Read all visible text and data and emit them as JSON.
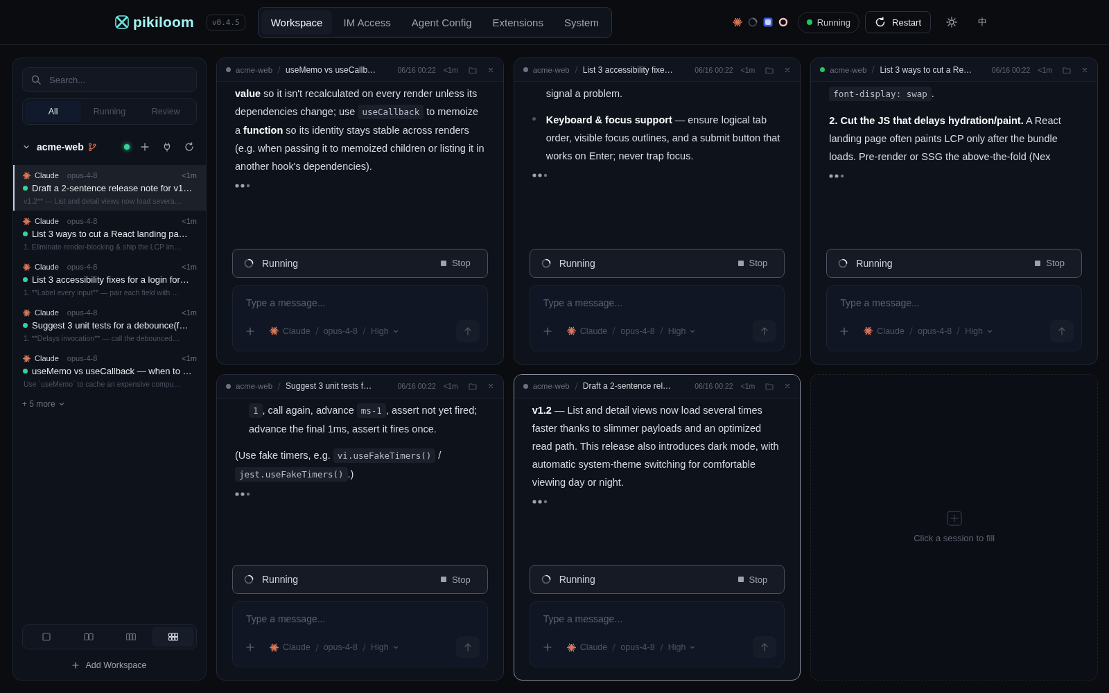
{
  "header": {
    "logo": "pikiloom",
    "version": "v0.4.5",
    "tabs": [
      {
        "label": "Workspace",
        "selected": true
      },
      {
        "label": "IM Access",
        "selected": false
      },
      {
        "label": "Agent Config",
        "selected": false
      },
      {
        "label": "Extensions",
        "selected": false
      },
      {
        "label": "System",
        "selected": false
      }
    ],
    "status": "Running",
    "restart": "Restart",
    "language": "中"
  },
  "sidebar": {
    "search": {
      "placeholder": "Search..."
    },
    "filters": [
      {
        "label": "All",
        "selected": true
      },
      {
        "label": "Running",
        "selected": false
      },
      {
        "label": "Review",
        "selected": false
      }
    ],
    "workspace": {
      "name": "acme-web",
      "expanded": true,
      "sessions": [
        {
          "agent": "Claude",
          "model": "opus-4-8",
          "age": "<1m",
          "title": "Draft a 2-sentence release note for v1…",
          "preview": "v1.2** — List and detail views now load severa…",
          "running": true,
          "selected": true
        },
        {
          "agent": "Claude",
          "model": "opus-4-8",
          "age": "<1m",
          "title": "List 3 ways to cut a React landing pa…",
          "preview": "1. Eliminate render-blocking & ship the LCP im…",
          "running": true,
          "selected": false
        },
        {
          "agent": "Claude",
          "model": "opus-4-8",
          "age": "<1m",
          "title": "List 3 accessibility fixes for a login for…",
          "preview": "1. **Label every input** — pair each field with …",
          "running": true,
          "selected": false
        },
        {
          "agent": "Claude",
          "model": "opus-4-8",
          "age": "<1m",
          "title": "Suggest 3 unit tests for a debounce(f…",
          "preview": "1. **Delays invocation** — call the debounced…",
          "running": true,
          "selected": false
        },
        {
          "agent": "Claude",
          "model": "opus-4-8",
          "age": "<1m",
          "title": "useMemo vs useCallback — when to …",
          "preview": "Use `useMemo` to cache an expensive compu…",
          "running": true,
          "selected": false
        }
      ],
      "more": "+ 5 more"
    },
    "layouts": [
      {
        "kind": "single",
        "selected": false
      },
      {
        "kind": "double",
        "selected": false
      },
      {
        "kind": "triple",
        "selected": false
      },
      {
        "kind": "grid",
        "selected": true
      }
    ],
    "add_workspace": "Add Workspace"
  },
  "panels": [
    {
      "workspace": "acme-web",
      "title": "useMemo vs useCallb…",
      "date": "06/16 00:22",
      "age": "<1m",
      "connected": false,
      "focused": false,
      "blocks": [
        {
          "kind": "para",
          "segments": [
            {
              "kind": "text",
              "text": "**value** so it isn't recalculated on every render unless its dependencies change; use "
            },
            {
              "kind": "code",
              "text": "useCallback"
            },
            {
              "kind": "text",
              "text": " to memoize a **function** so its identity stays stable across renders (e.g. when passing it to memoized children or listing it in another hook's dependencies)."
            }
          ]
        }
      ],
      "run_status": "Running",
      "stop": "Stop",
      "composer": {
        "placeholder": "Type a message...",
        "agent": "Claude",
        "model": "opus-4-8",
        "effort": "High"
      }
    },
    {
      "workspace": "acme-web",
      "title": "List 3 accessibility fixe…",
      "date": "06/16 00:22",
      "age": "<1m",
      "connected": false,
      "focused": false,
      "blocks": [
        {
          "kind": "item_cont",
          "segments": [
            {
              "kind": "text",
              "text": "signal a problem."
            }
          ]
        },
        {
          "kind": "item",
          "segments": [
            {
              "kind": "text",
              "text": "**Keyboard & focus support** — ensure logical tab order, visible focus outlines, and a submit button that works on Enter; never trap focus."
            }
          ]
        }
      ],
      "run_status": "Running",
      "stop": "Stop",
      "composer": {
        "placeholder": "Type a message...",
        "agent": "Claude",
        "model": "opus-4-8",
        "effort": "High"
      }
    },
    {
      "workspace": "acme-web",
      "title": "List 3 ways to cut a Re…",
      "date": "06/16 00:22",
      "age": "<1m",
      "connected": true,
      "focused": false,
      "blocks": [
        {
          "kind": "para",
          "segments": [
            {
              "kind": "code",
              "text": "font-display: swap"
            },
            {
              "kind": "text",
              "text": "."
            }
          ]
        },
        {
          "kind": "para",
          "segments": [
            {
              "kind": "text",
              "text": "**2. Cut the JS that delays hydration/paint.** A React landing page often paints LCP only after the bundle loads. Pre-render or SSG the above-the-fold (Nex"
            }
          ]
        }
      ],
      "run_status": "Running",
      "stop": "Stop",
      "composer": {
        "placeholder": "Type a message...",
        "agent": "Claude",
        "model": "opus-4-8",
        "effort": "High"
      }
    },
    {
      "workspace": "acme-web",
      "title": "Suggest 3 unit tests f…",
      "date": "06/16 00:22",
      "age": "<1m",
      "connected": false,
      "focused": false,
      "blocks": [
        {
          "kind": "item_cont",
          "segments": [
            {
              "kind": "code",
              "text": "1"
            },
            {
              "kind": "text",
              "text": ", call again, advance "
            },
            {
              "kind": "code",
              "text": "ms-1"
            },
            {
              "kind": "text",
              "text": ", assert not yet fired; advance the final 1ms, assert it fires once."
            }
          ]
        },
        {
          "kind": "para",
          "segments": [
            {
              "kind": "text",
              "text": "(Use fake timers, e.g. "
            },
            {
              "kind": "code",
              "text": "vi.useFakeTimers()"
            },
            {
              "kind": "text",
              "text": " / "
            },
            {
              "kind": "code",
              "text": "jest.useFakeTimers()"
            },
            {
              "kind": "text",
              "text": ".)"
            }
          ]
        }
      ],
      "run_status": "Running",
      "stop": "Stop",
      "composer": {
        "placeholder": "Type a message...",
        "agent": "Claude",
        "model": "opus-4-8",
        "effort": "High"
      }
    },
    {
      "workspace": "acme-web",
      "title": "Draft a 2-sentence rel…",
      "date": "06/16 00:22",
      "age": "<1m",
      "connected": false,
      "focused": true,
      "blocks": [
        {
          "kind": "para",
          "segments": [
            {
              "kind": "text",
              "text": "**v1.2** — List and detail views now load several times faster thanks to slimmer payloads and an optimized read path. This release also introduces dark mode, with automatic system-theme switching for comfortable viewing day or night."
            }
          ]
        }
      ],
      "run_status": "Running",
      "stop": "Stop",
      "composer": {
        "placeholder": "Type a message...",
        "agent": "Claude",
        "model": "opus-4-8",
        "effort": "High"
      }
    }
  ],
  "empty_slot": {
    "hint": "Click a session to fill"
  }
}
